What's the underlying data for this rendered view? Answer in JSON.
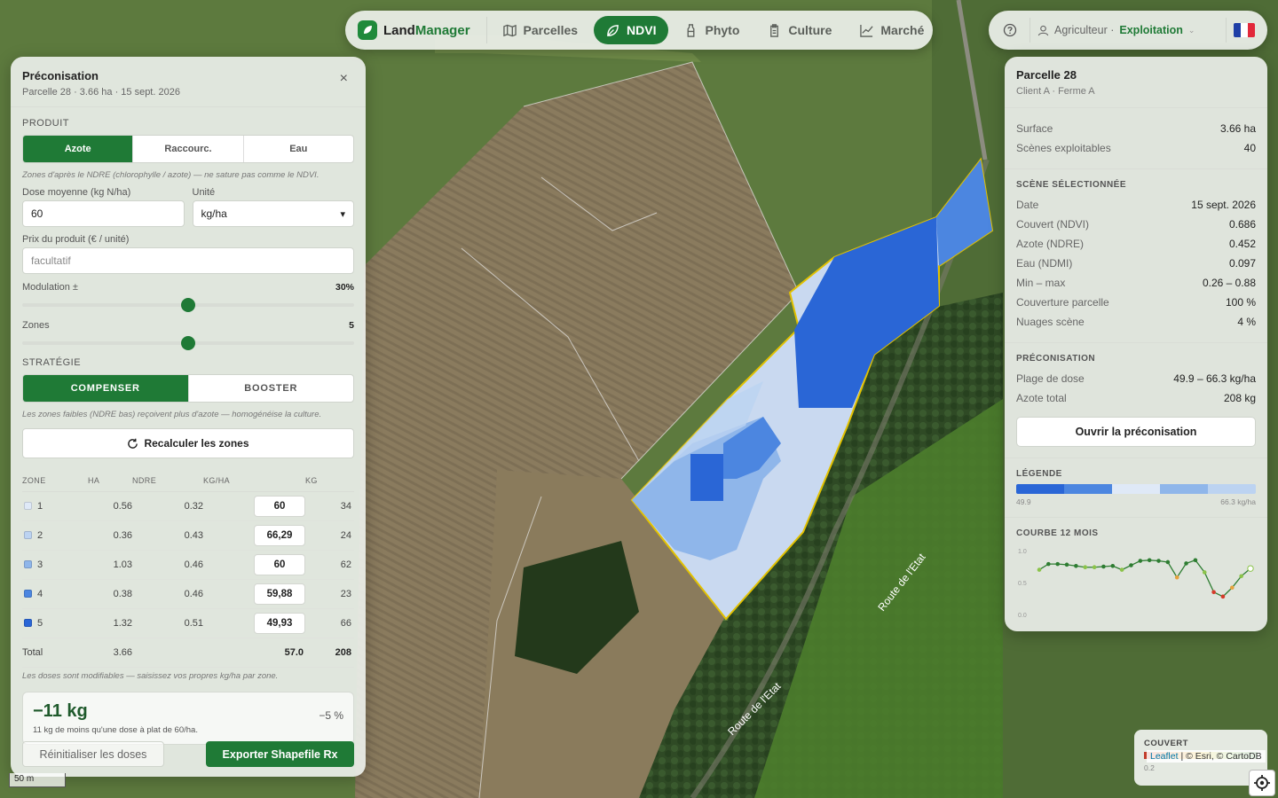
{
  "nav": {
    "brand_a": "Land",
    "brand_b": "Manager",
    "tabs": [
      {
        "label": "Parcelles",
        "icon": "map-icon"
      },
      {
        "label": "NDVI",
        "icon": "leaf-icon"
      },
      {
        "label": "Phyto",
        "icon": "bottle-icon"
      },
      {
        "label": "Culture",
        "icon": "clipboard-icon"
      },
      {
        "label": "Marché",
        "icon": "chart-line-icon"
      }
    ],
    "active_tab": "NDVI",
    "user_role": "Agriculteur · ",
    "user_farm": "Exploitation",
    "flag_colors": [
      "#1f3fa6",
      "#ffffff",
      "#e2283a"
    ]
  },
  "preco": {
    "title": "Préconisation",
    "subtitle": "Parcelle 28 · 3.66 ha · 15 sept. 2026",
    "close": "×",
    "product_label": "PRODUIT",
    "products": [
      "Azote",
      "Raccourc.",
      "Eau"
    ],
    "product_hint": "Zones d'après le NDRE (chlorophylle / azote) — ne sature pas comme le NDVI.",
    "dose_label": "Dose moyenne (kg N/ha)",
    "dose_value": "60",
    "unit_label": "Unité",
    "unit_value": "kg/ha",
    "price_label": "Prix du produit (€ / unité)",
    "price_placeholder": "facultatif",
    "modulation_label": "Modulation ±",
    "modulation_value": "30%",
    "modulation_level": 0.5,
    "zones_label": "Zones",
    "zones_value": "5",
    "zones_level": 0.5,
    "strategy_label": "STRATÉGIE",
    "strategies": [
      "COMPENSER",
      "BOOSTER"
    ],
    "strategy_hint": "Les zones faibles (NDRE bas) reçoivent plus d'azote — homogénéise la culture.",
    "recalc": "Recalculer les zones",
    "headers": [
      "ZONE",
      "HA",
      "NDRE",
      "KG/HA",
      "KG"
    ],
    "zones": [
      {
        "zone": "1",
        "ha": "0.56",
        "ndre": "0.32",
        "dose": "60",
        "kg": "34",
        "color": "#dfe9f7"
      },
      {
        "zone": "2",
        "ha": "0.36",
        "ndre": "0.43",
        "dose": "66,29",
        "kg": "24",
        "color": "#bcd3f1"
      },
      {
        "zone": "3",
        "ha": "1.03",
        "ndre": "0.46",
        "dose": "60",
        "kg": "62",
        "color": "#8fb6ea"
      },
      {
        "zone": "4",
        "ha": "0.38",
        "ndre": "0.46",
        "dose": "59,88",
        "kg": "23",
        "color": "#4c86e0"
      },
      {
        "zone": "5",
        "ha": "1.32",
        "ndre": "0.51",
        "dose": "49,93",
        "kg": "66",
        "color": "#2a66d6"
      }
    ],
    "total_label": "Total",
    "total_ha": "3.66",
    "total_dose": "57.0",
    "total_kg": "208",
    "table_hint": "Les doses sont modifiables — saisissez vos propres kg/ha par zone.",
    "saving_big": "−11 kg",
    "saving_pct": "−5 %",
    "saving_sub": "11 kg de moins qu'une dose à plat de 60/ha.",
    "reset": "Réinitialiser les doses",
    "export": "Exporter Shapefile Rx"
  },
  "parcel": {
    "title": "Parcelle 28",
    "subtitle": "Client A · Ferme A",
    "surface_label": "Surface",
    "surface": "3.66 ha",
    "scenes_label": "Scènes exploitables",
    "scenes": "40",
    "scene_section": "SCÈNE SÉLECTIONNÉE",
    "date_label": "Date",
    "date": "15 sept. 2026",
    "ndvi_label": "Couvert (NDVI)",
    "ndvi": "0.686",
    "ndre_label": "Azote (NDRE)",
    "ndre": "0.452",
    "ndmi_label": "Eau (NDMI)",
    "ndmi": "0.097",
    "minmax_label": "Min – max",
    "minmax": "0.26 – 0.88",
    "coverage_label": "Couverture parcelle",
    "coverage": "100 %",
    "clouds_label": "Nuages scène",
    "clouds": "4 %",
    "preco_section": "PRÉCONISATION",
    "range_label": "Plage de dose",
    "range": "49.9 – 66.3 kg/ha",
    "nitro_label": "Azote total",
    "nitro": "208 kg",
    "open_btn": "Ouvrir la préconisation",
    "legend_section": "LÉGENDE",
    "legend_colors": [
      "#2a66d6",
      "#4c86e0",
      "#dfe9f7",
      "#8fb6ea",
      "#bcd3f1"
    ],
    "legend_min": "49.9",
    "legend_max": "66.3 kg/ha",
    "curve_section": "COURBE 12 MOIS"
  },
  "chart_data": {
    "type": "line",
    "title": "COURBE 12 MOIS",
    "yticks": [
      "1.0",
      "0.5",
      "0.0"
    ],
    "ylim": [
      0,
      1
    ],
    "values": [
      0.7,
      0.79,
      0.79,
      0.78,
      0.76,
      0.74,
      0.74,
      0.75,
      0.76,
      0.7,
      0.77,
      0.84,
      0.85,
      0.84,
      0.82,
      0.58,
      0.8,
      0.85,
      0.66,
      0.35,
      0.28,
      0.42,
      0.6,
      0.72
    ],
    "grid": false,
    "legend": "none"
  },
  "map": {
    "scale": "50 m",
    "road_a": "Route de l'Etat",
    "road_b": "Route de l'Etat",
    "couvert_title": "COUVERT",
    "couvert_min": "0.2",
    "attrib_leaflet": "Leaflet",
    "attrib_rest": " | © Esri, © CartoDB"
  }
}
